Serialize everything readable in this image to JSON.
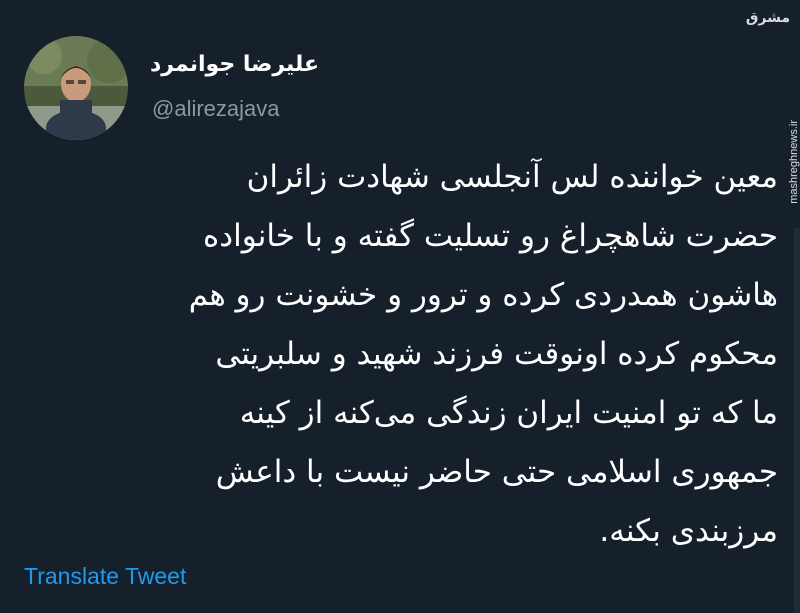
{
  "tweet": {
    "author": {
      "display_name": "علیرضا جوانمرد",
      "handle": "@alirezajava"
    },
    "body_lines": [
      "معین خواننده لس آنجلسی شهادت زائران",
      "حضرت شاهچراغ رو تسلیت گفته و با خانواده",
      "هاشون همدردی کرده و ترور و خشونت رو هم",
      "محکوم کرده اونوقت فرزند شهید و سلبریتی",
      "ما که تو امنیت ایران زندگی می‌کنه از کینه",
      "جمهوری اسلامی حتی حاضر نیست با داعش",
      "مرزبندی بکنه."
    ],
    "translate_label": "Translate Tweet"
  },
  "watermark": {
    "logo_text": "مشرق",
    "url_text": "mashreghnews.ir"
  },
  "colors": {
    "background": "#15202b",
    "text_primary": "#ffffff",
    "text_secondary": "#8899a6",
    "link": "#1d9bf0"
  }
}
